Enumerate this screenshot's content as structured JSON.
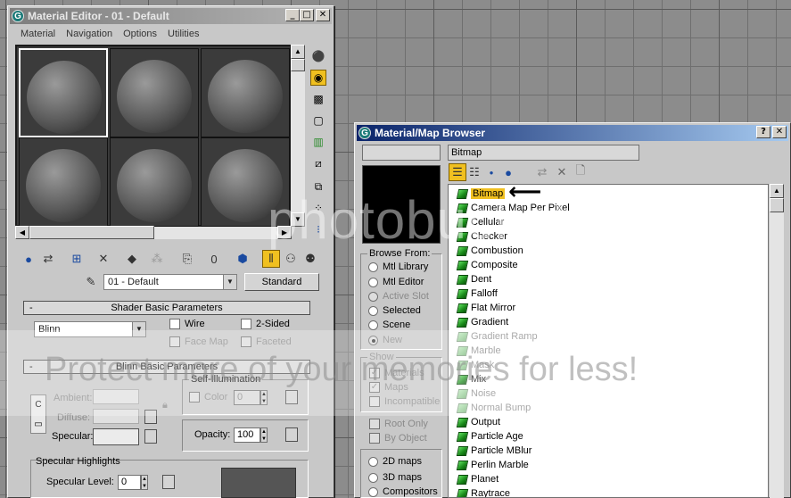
{
  "material_editor": {
    "title": "Material Editor - 01 - Default",
    "menu": [
      "Material",
      "Navigation",
      "Options",
      "Utilities"
    ],
    "material_name": "01 - Default",
    "type_button": "Standard",
    "shader_rollout": {
      "title": "Shader Basic Parameters",
      "shader": "Blinn",
      "wire": "Wire",
      "two_sided": "2-Sided",
      "face_map": "Face Map",
      "faceted": "Faceted"
    },
    "blinn_rollout": {
      "title": "Blinn Basic Parameters",
      "ambient": "Ambient:",
      "diffuse": "Diffuse:",
      "specular": "Specular:",
      "self_illum_title": "Self-Illumination",
      "color_label": "Color",
      "color_value": "0",
      "opacity_label": "Opacity:",
      "opacity_value": "100"
    },
    "spec_rollout": {
      "title": "Specular Highlights",
      "level_label": "Specular Level:",
      "level_value": "0"
    }
  },
  "browser": {
    "title": "Material/Map Browser",
    "name_value": "Bitmap",
    "browse_from": {
      "title": "Browse From:",
      "options": [
        "Mtl Library",
        "Mtl Editor",
        "Active Slot",
        "Selected",
        "Scene",
        "New"
      ]
    },
    "show": {
      "title": "Show",
      "materials": "Materials",
      "maps": "Maps",
      "incompatible": "Incompatible"
    },
    "root_only": "Root Only",
    "by_object": "By Object",
    "map_types": [
      "2D maps",
      "3D maps",
      "Compositors"
    ],
    "maps": [
      {
        "name": "Bitmap",
        "dim": false,
        "selected": true
      },
      {
        "name": "Camera Map Per Pixel",
        "dim": false
      },
      {
        "name": "Cellular",
        "dim": false
      },
      {
        "name": "Checker",
        "dim": false
      },
      {
        "name": "Combustion",
        "dim": false
      },
      {
        "name": "Composite",
        "dim": false
      },
      {
        "name": "Dent",
        "dim": false
      },
      {
        "name": "Falloff",
        "dim": false
      },
      {
        "name": "Flat Mirror",
        "dim": false
      },
      {
        "name": "Gradient",
        "dim": false
      },
      {
        "name": "Gradient Ramp",
        "dim": true
      },
      {
        "name": "Marble",
        "dim": true
      },
      {
        "name": "Mask",
        "dim": true
      },
      {
        "name": "Mix",
        "dim": false
      },
      {
        "name": "Noise",
        "dim": true
      },
      {
        "name": "Normal Bump",
        "dim": true
      },
      {
        "name": "Output",
        "dim": false
      },
      {
        "name": "Particle Age",
        "dim": false
      },
      {
        "name": "Particle MBlur",
        "dim": false
      },
      {
        "name": "Perlin Marble",
        "dim": false
      },
      {
        "name": "Planet",
        "dim": false
      },
      {
        "name": "Raytrace",
        "dim": false
      }
    ]
  },
  "watermark": {
    "logo": "photobucket",
    "tagline": "Protect more of your memories for less!"
  },
  "colors": {
    "highlight": "#f0c020",
    "title_active": "#0a246a",
    "gem_green": "#1a8a1a"
  }
}
